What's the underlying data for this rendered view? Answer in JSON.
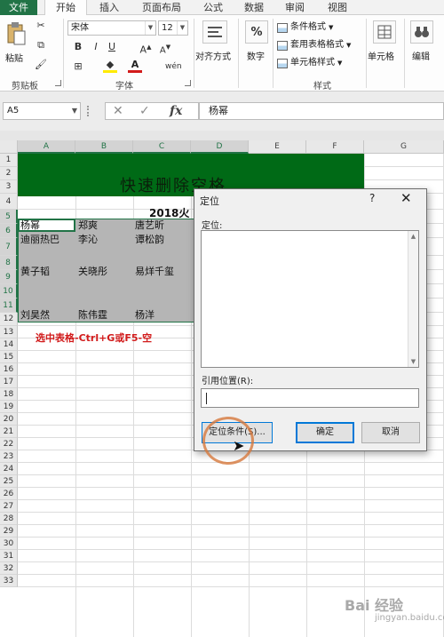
{
  "ribbon_tabs": [
    "文件",
    "开始",
    "插入",
    "页面布局",
    "公式",
    "数据",
    "审阅",
    "视图"
  ],
  "ribbon": {
    "paste_label": "粘贴",
    "clipboard_label": "剪贴板",
    "font_name": "宋体",
    "font_size": "12",
    "bold": "B",
    "italic": "I",
    "underline": "U",
    "font_label": "字体",
    "alignment_label": "对齐方式",
    "number_label": "数字",
    "number_symbol": "%",
    "conditional_format": "条件格式",
    "table_format": "套用表格格式",
    "cell_styles": "单元格样式",
    "styles_label": "样式",
    "cells_label": "单元格",
    "editing_label": "编辑"
  },
  "formula_bar": {
    "name_box": "A5",
    "content": "杨幂"
  },
  "columns": [
    "A",
    "B",
    "C",
    "D",
    "E",
    "F",
    "G"
  ],
  "rows": [
    "1",
    "2",
    "3",
    "4",
    "5",
    "6",
    "7",
    "8",
    "9",
    "10",
    "11",
    "12",
    "13",
    "14",
    "15",
    "16",
    "17",
    "18",
    "19",
    "20",
    "21",
    "22",
    "23",
    "24",
    "25",
    "26",
    "27",
    "28",
    "29",
    "30",
    "31",
    "32",
    "33"
  ],
  "sheet": {
    "title": "快速删除空格",
    "subtitle": "2018火",
    "cells": {
      "a5": "杨幂",
      "b5": "郑爽",
      "c5": "唐艺昕",
      "a6": "迪丽热巴",
      "b6": "李沁",
      "c6": "谭松韵",
      "a8": "黄子韬",
      "b8": "关晓彤",
      "c8": "易烊千玺",
      "a11": "刘昊然",
      "b11": "陈伟霆",
      "c11": "杨洋"
    },
    "note": "选中表格-Ctrl+G或F5-空"
  },
  "dialog": {
    "title": "定位",
    "help": "?",
    "close": "✕",
    "goto_label": "定位:",
    "reference_label": "引用位置(R):",
    "reference_value": "",
    "special_button": "定位条件(S)...",
    "ok_button": "确定",
    "cancel_button": "取消"
  },
  "watermark": "Bai 经验",
  "watermark_sub": "jingyan.baidu.com",
  "colors": {
    "excel_green": "#217346",
    "title_green": "#006a16",
    "note_red": "#d21b1b"
  }
}
